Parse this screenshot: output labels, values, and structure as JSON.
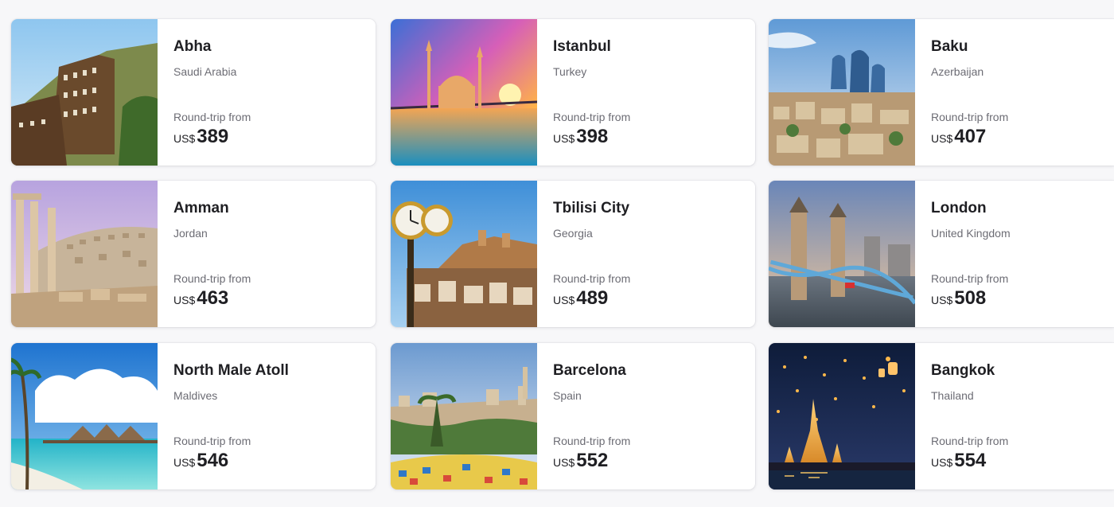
{
  "price_label": "Round-trip from",
  "currency": "US$",
  "destinations": [
    {
      "city": "Abha",
      "country": "Saudi Arabia",
      "price": "389",
      "image": "abha-village-photo"
    },
    {
      "city": "Istanbul",
      "country": "Turkey",
      "price": "398",
      "image": "istanbul-mosque-sunset-photo"
    },
    {
      "city": "Baku",
      "country": "Azerbaijan",
      "price": "407",
      "image": "baku-flame-towers-photo"
    },
    {
      "city": "Amman",
      "country": "Jordan",
      "price": "463",
      "image": "amman-citadel-columns-photo"
    },
    {
      "city": "Tbilisi City",
      "country": "Georgia",
      "price": "489",
      "image": "tbilisi-clock-fortress-photo"
    },
    {
      "city": "London",
      "country": "United Kingdom",
      "price": "508",
      "image": "london-tower-bridge-photo"
    },
    {
      "city": "North Male Atoll",
      "country": "Maldives",
      "price": "546",
      "image": "maldives-beach-villas-photo"
    },
    {
      "city": "Barcelona",
      "country": "Spain",
      "price": "552",
      "image": "barcelona-park-guell-photo"
    },
    {
      "city": "Bangkok",
      "country": "Thailand",
      "price": "554",
      "image": "bangkok-temple-lanterns-photo"
    }
  ]
}
